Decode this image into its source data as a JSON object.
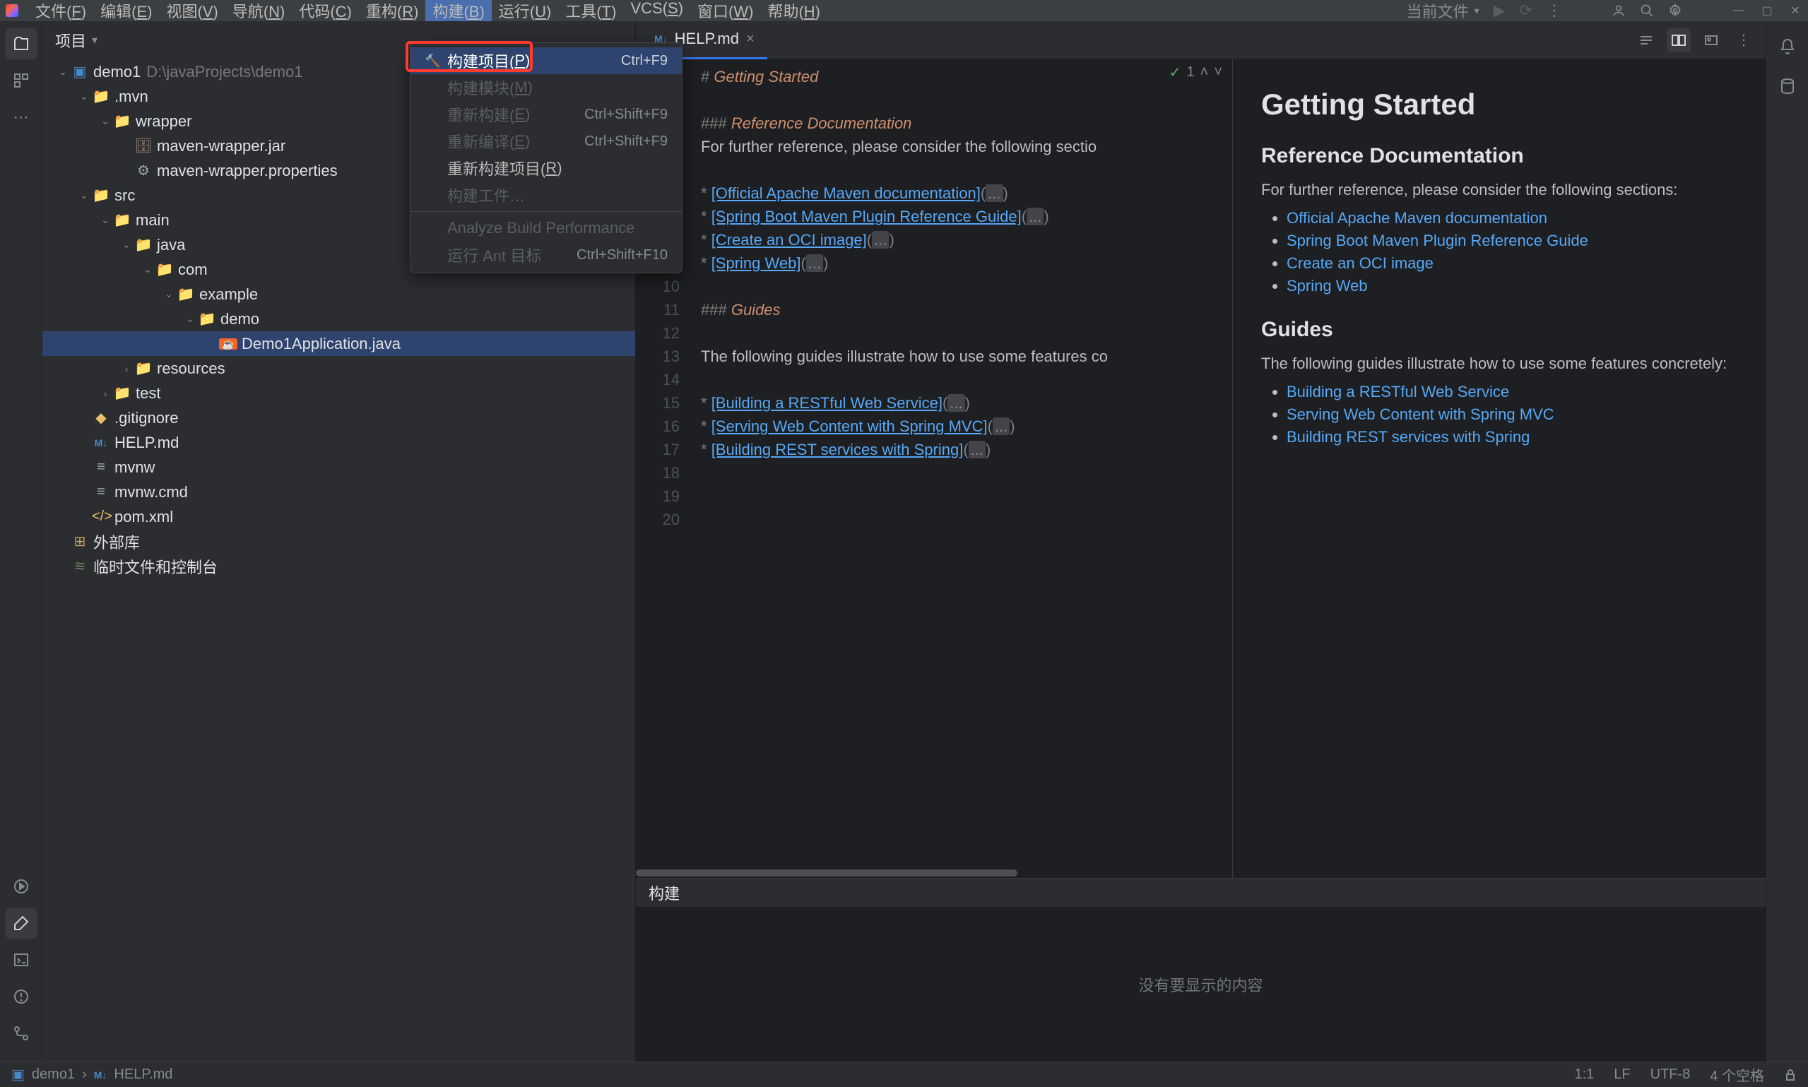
{
  "menubar": {
    "items": [
      "文件(F)",
      "编辑(E)",
      "视图(V)",
      "导航(N)",
      "代码(C)",
      "重构(R)",
      "构建(B)",
      "运行(U)",
      "工具(T)",
      "VCS(S)",
      "窗口(W)",
      "帮助(H)"
    ],
    "active_index": 6
  },
  "titlebar_right": {
    "run_config": "当前文件"
  },
  "dropdown": {
    "items": [
      {
        "label": "构建项目(P)",
        "shortcut": "Ctrl+F9",
        "icon": "hammer",
        "highlighted": true
      },
      {
        "label": "构建模块(M)",
        "disabled": true
      },
      {
        "label": "重新构建(E)",
        "shortcut": "Ctrl+Shift+F9",
        "disabled": true
      },
      {
        "label": "重新编译(E)",
        "shortcut": "Ctrl+Shift+F9",
        "disabled": true
      },
      {
        "label": "重新构建项目(R)"
      },
      {
        "label": "构建工件…",
        "disabled": true
      },
      {
        "sep": true
      },
      {
        "label": "Analyze Build Performance",
        "disabled": true
      },
      {
        "label": "运行 Ant 目标",
        "shortcut": "Ctrl+Shift+F10",
        "disabled": true
      }
    ]
  },
  "project_panel": {
    "title": "项目"
  },
  "tree": [
    {
      "d": 0,
      "arrow": "v",
      "icon": "module",
      "label": "demo1",
      "hint": "D:\\javaProjects\\demo1"
    },
    {
      "d": 1,
      "arrow": "v",
      "icon": "folder",
      "label": ".mvn"
    },
    {
      "d": 2,
      "arrow": "v",
      "icon": "folder",
      "label": "wrapper"
    },
    {
      "d": 3,
      "icon": "jar",
      "label": "maven-wrapper.jar"
    },
    {
      "d": 3,
      "icon": "gear",
      "label": "maven-wrapper.properties"
    },
    {
      "d": 1,
      "arrow": "v",
      "icon": "folder-src",
      "label": "src"
    },
    {
      "d": 2,
      "arrow": "v",
      "icon": "folder-src",
      "label": "main"
    },
    {
      "d": 3,
      "arrow": "v",
      "icon": "folder-src",
      "label": "java"
    },
    {
      "d": 4,
      "arrow": "v",
      "icon": "package",
      "label": "com"
    },
    {
      "d": 5,
      "arrow": "v",
      "icon": "package",
      "label": "example"
    },
    {
      "d": 6,
      "arrow": "v",
      "icon": "package",
      "label": "demo"
    },
    {
      "d": 7,
      "icon": "java",
      "label": "Demo1Application.java",
      "selected": true
    },
    {
      "d": 3,
      "arrow": ">",
      "icon": "folder-res",
      "label": "resources"
    },
    {
      "d": 2,
      "arrow": ">",
      "icon": "folder-test",
      "label": "test"
    },
    {
      "d": 1,
      "icon": "git",
      "label": ".gitignore"
    },
    {
      "d": 1,
      "icon": "md",
      "label": "HELP.md"
    },
    {
      "d": 1,
      "icon": "file",
      "label": "mvnw"
    },
    {
      "d": 1,
      "icon": "file",
      "label": "mvnw.cmd"
    },
    {
      "d": 1,
      "icon": "xml",
      "label": "pom.xml"
    },
    {
      "d": 0,
      "icon": "lib",
      "label": "外部库"
    },
    {
      "d": 0,
      "icon": "scratch",
      "label": "临时文件和控制台"
    }
  ],
  "tab": {
    "label": "HELP.md"
  },
  "code_header": {
    "check": "1"
  },
  "gutter": [
    1,
    2,
    3,
    4,
    5,
    6,
    7,
    8,
    9,
    10,
    11,
    12,
    13,
    14,
    15,
    16,
    17,
    18,
    19,
    20
  ],
  "code_lines": [
    {
      "t": "# ",
      "s": "gray",
      "r": "Getting Started",
      "rs": "orange-i"
    },
    {
      "blank": true
    },
    {
      "t": "### ",
      "r": "Reference Documentation",
      "rs": "orange-i"
    },
    {
      "t": "For further reference, please consider the following sectio"
    },
    {
      "blank": true
    },
    {
      "b": "*",
      "link": "[Official Apache Maven documentation]",
      "fold": "..."
    },
    {
      "b": "*",
      "link": "[Spring Boot Maven Plugin Reference Guide]",
      "fold": "..."
    },
    {
      "b": "*",
      "link": "[Create an OCI image]",
      "fold": "..."
    },
    {
      "b": "*",
      "link": "[Spring Web]",
      "fold": "..."
    },
    {
      "blank": true
    },
    {
      "t": "### ",
      "r": "Guides",
      "rs": "orange-i"
    },
    {
      "blank": true
    },
    {
      "t": "The following guides illustrate how to use some features co"
    },
    {
      "blank": true
    },
    {
      "b": "*",
      "link": "[Building a RESTful Web Service]",
      "fold": "..."
    },
    {
      "b": "*",
      "link": "[Serving Web Content with Spring MVC]",
      "fold": "..."
    },
    {
      "b": "*",
      "link": "[Building REST services with Spring]",
      "fold": "..."
    },
    {
      "blank": true
    },
    {
      "blank": true
    }
  ],
  "preview": {
    "h1": "Getting Started",
    "h2a": "Reference Documentation",
    "p1": "For further reference, please consider the following sections:",
    "links1": [
      "Official Apache Maven documentation",
      "Spring Boot Maven Plugin Reference Guide",
      "Create an OCI image",
      "Spring Web"
    ],
    "h2b": "Guides",
    "p2": "The following guides illustrate how to use some features concretely:",
    "links2": [
      "Building a RESTful Web Service",
      "Serving Web Content with Spring MVC",
      "Building REST services with Spring"
    ]
  },
  "bottom": {
    "title": "构建",
    "empty": "没有要显示的内容"
  },
  "breadcrumb": [
    "demo1",
    "HELP.md"
  ],
  "status": {
    "pos": "1:1",
    "sep": "LF",
    "enc": "UTF-8",
    "indent": "4 个空格"
  }
}
